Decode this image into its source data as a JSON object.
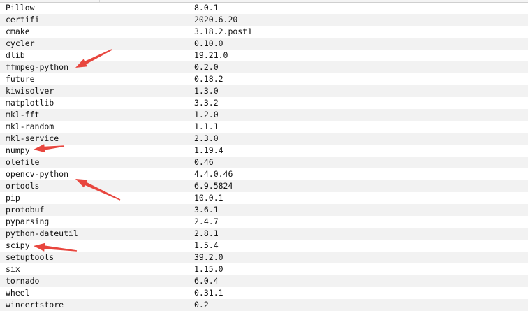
{
  "packages": [
    {
      "name": "Pillow",
      "version": "8.0.1"
    },
    {
      "name": "certifi",
      "version": "2020.6.20"
    },
    {
      "name": "cmake",
      "version": "3.18.2.post1"
    },
    {
      "name": "cycler",
      "version": "0.10.0"
    },
    {
      "name": "dlib",
      "version": "19.21.0"
    },
    {
      "name": "ffmpeg-python",
      "version": "0.2.0"
    },
    {
      "name": "future",
      "version": "0.18.2"
    },
    {
      "name": "kiwisolver",
      "version": "1.3.0"
    },
    {
      "name": "matplotlib",
      "version": "3.3.2"
    },
    {
      "name": "mkl-fft",
      "version": "1.2.0"
    },
    {
      "name": "mkl-random",
      "version": "1.1.1"
    },
    {
      "name": "mkl-service",
      "version": "2.3.0"
    },
    {
      "name": "numpy",
      "version": "1.19.4"
    },
    {
      "name": "olefile",
      "version": "0.46"
    },
    {
      "name": "opencv-python",
      "version": "4.4.0.46"
    },
    {
      "name": "ortools",
      "version": "6.9.5824"
    },
    {
      "name": "pip",
      "version": "10.0.1"
    },
    {
      "name": "protobuf",
      "version": "3.6.1"
    },
    {
      "name": "pyparsing",
      "version": "2.4.7"
    },
    {
      "name": "python-dateutil",
      "version": "2.8.1"
    },
    {
      "name": "scipy",
      "version": "1.5.4"
    },
    {
      "name": "setuptools",
      "version": "39.2.0"
    },
    {
      "name": "six",
      "version": "1.15.0"
    },
    {
      "name": "tornado",
      "version": "6.0.4"
    },
    {
      "name": "wheel",
      "version": "0.31.1"
    },
    {
      "name": "wincertstore",
      "version": "0.2"
    }
  ],
  "annotation_color": "#e8463e",
  "annotated_packages": [
    "ffmpeg-python",
    "numpy",
    "opencv-python",
    "scipy"
  ]
}
